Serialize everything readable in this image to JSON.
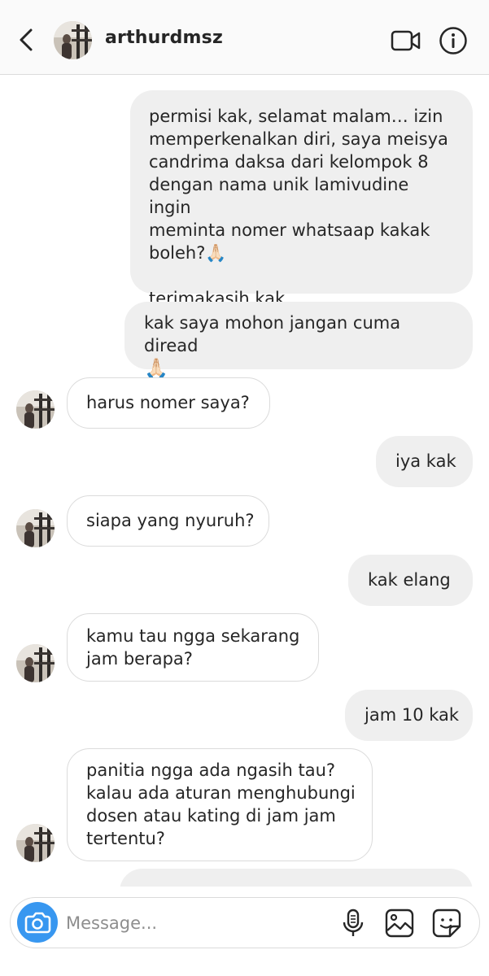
{
  "header": {
    "username": "arthurdmsz"
  },
  "messages": [
    {
      "type": "sent",
      "lines": [
        "permisi kak, selamat malam… izin",
        "memperkenalkan diri, saya meisya",
        "candrima daksa dari kelompok 8",
        "dengan nama unik lamivudine ingin",
        "meminta nomer whatsaap kakak",
        "boleh?🙏🏻",
        "",
        "terimakasih kak"
      ]
    },
    {
      "type": "sent",
      "lines": [
        "kak saya mohon jangan cuma diread",
        "🙏🏻"
      ]
    },
    {
      "type": "received",
      "lines": [
        "harus nomer saya?"
      ]
    },
    {
      "type": "sent",
      "lines": [
        "iya kak"
      ]
    },
    {
      "type": "received",
      "lines": [
        "siapa yang nyuruh?"
      ]
    },
    {
      "type": "sent",
      "lines": [
        "kak elang"
      ]
    },
    {
      "type": "received",
      "lines": [
        "kamu tau ngga sekarang",
        "jam berapa?"
      ]
    },
    {
      "type": "sent",
      "lines": [
        "jam 10 kak"
      ]
    },
    {
      "type": "received",
      "lines": [
        "panitia ngga ada ngasih tau?",
        "kalau ada aturan menghubungi",
        "dosen atau kating di jam jam",
        "tertentu?"
      ]
    },
    {
      "type": "sent",
      "lines": [
        "…"
      ]
    }
  ],
  "composer": {
    "placeholder": "Message..."
  },
  "icons": {
    "back": "chevron-left-icon",
    "video": "video-camera-icon",
    "info": "info-icon",
    "camera": "camera-icon",
    "mic": "microphone-icon",
    "gallery": "image-icon",
    "sticker": "sticker-icon"
  },
  "colors": {
    "sent_bubble": "#efefef",
    "received_border": "#dbdbdb",
    "camera_button": "#3897f0",
    "text": "#262626",
    "placeholder": "#8e8e8e"
  }
}
